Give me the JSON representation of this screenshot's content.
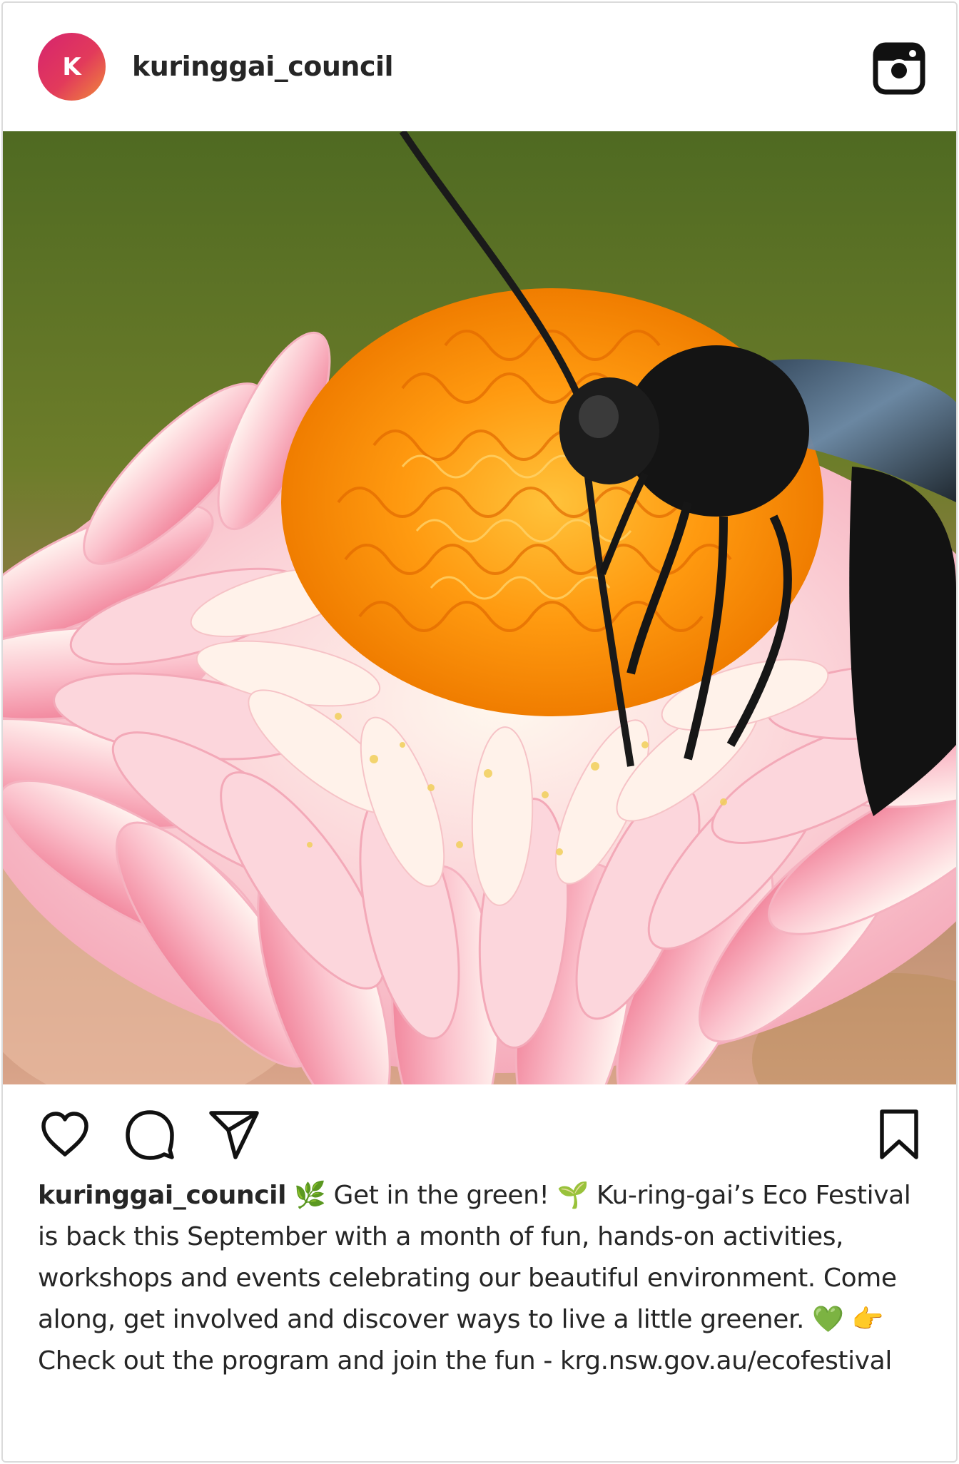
{
  "header": {
    "avatar_letter": "K",
    "username": "kuringgai_council",
    "icon": "instagram-icon"
  },
  "photo": {
    "subject": "flower-with-insect"
  },
  "actions": {
    "like_icon": "heart-icon",
    "comment_icon": "comment-bubble-icon",
    "share_icon": "paper-plane-icon",
    "save_icon": "bookmark-icon"
  },
  "caption": {
    "username": "kuringgai_council",
    "text": "🌿 Get in the green! 🌱 Ku-ring-gai’s Eco Festival is back this September with a month of fun, hands-on activities, workshops and events celebrating our beautiful environment. Come along, get involved and discover ways to live a little greener. 💚 👉 Check out the program and join the fun - krg.nsw.gov.au/ecofestival"
  },
  "colors": {
    "text": "#262626",
    "border": "#dbdbdb",
    "avatar_gradient_start": "#d6246e",
    "avatar_gradient_end": "#f08a3a"
  }
}
